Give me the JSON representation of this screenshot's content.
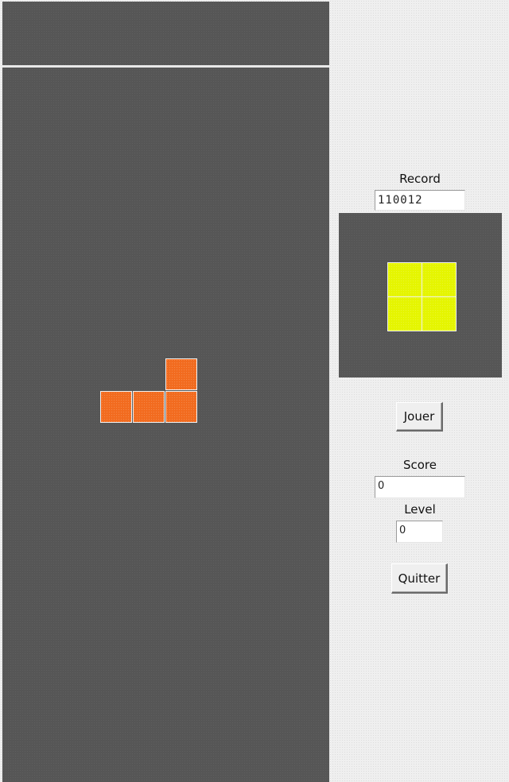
{
  "board": {
    "background_color": "#565656",
    "current_piece": {
      "shape": "L",
      "color": "#f26b1f"
    }
  },
  "sidebar": {
    "record": {
      "label": "Record",
      "value": "110012"
    },
    "next_piece": {
      "shape": "O",
      "color": "#e5f500"
    },
    "play_button_label": "Jouer",
    "score": {
      "label": "Score",
      "value": "0"
    },
    "level": {
      "label": "Level",
      "value": "0"
    },
    "quit_button_label": "Quitter"
  }
}
